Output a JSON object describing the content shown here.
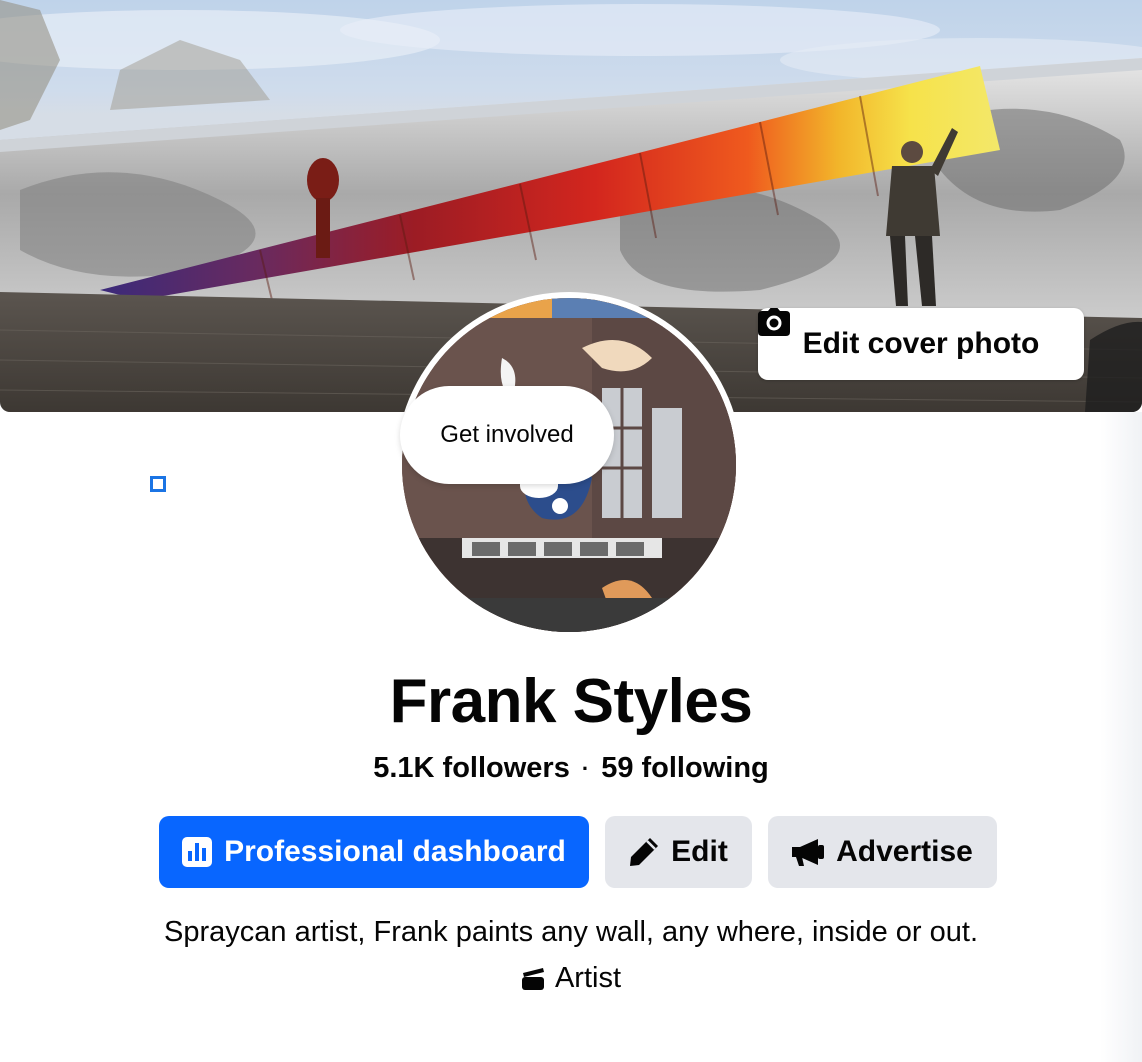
{
  "cover": {
    "edit_label": "Edit cover photo",
    "icon": "camera-icon"
  },
  "avatar": {
    "tooltip": "Get involved"
  },
  "profile": {
    "name": "Frank Styles",
    "followers": "5.1K followers",
    "separator": "·",
    "following": "59 following"
  },
  "actions": {
    "dashboard_label": "Professional dashboard",
    "dashboard_icon": "bar-chart-icon",
    "edit_label": "Edit",
    "edit_icon": "pencil-icon",
    "advertise_label": "Advertise",
    "advertise_icon": "megaphone-icon"
  },
  "about": {
    "bio": "Spraycan artist, Frank paints any wall, any where, inside or out.",
    "category": "Artist",
    "category_icon": "clapperboard-icon"
  },
  "colors": {
    "primary": "#0866ff",
    "secondary_button": "#e4e6eb",
    "text": "#050505"
  }
}
